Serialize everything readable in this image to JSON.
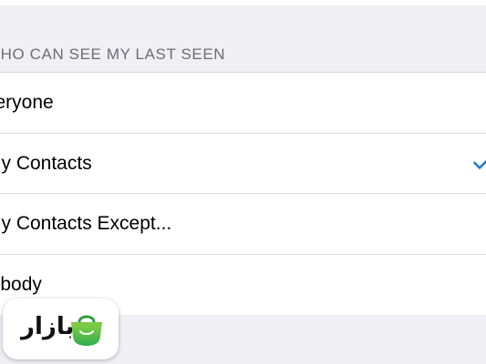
{
  "section": {
    "header": "WHO CAN SEE MY LAST SEEN"
  },
  "options": [
    {
      "label": "veryone",
      "selected": false
    },
    {
      "label": "My Contacts",
      "selected": true
    },
    {
      "label": "My Contacts Except...",
      "selected": false
    },
    {
      "label": "lobody",
      "selected": false
    }
  ],
  "checkmark_icon": "checkmark-icon",
  "badge": {
    "text": "بازار",
    "icon": "shopping-bag-icon"
  },
  "colors": {
    "background": "#efeff4",
    "accent": "#1a7ad4",
    "badge_green": "#3cb44a"
  }
}
